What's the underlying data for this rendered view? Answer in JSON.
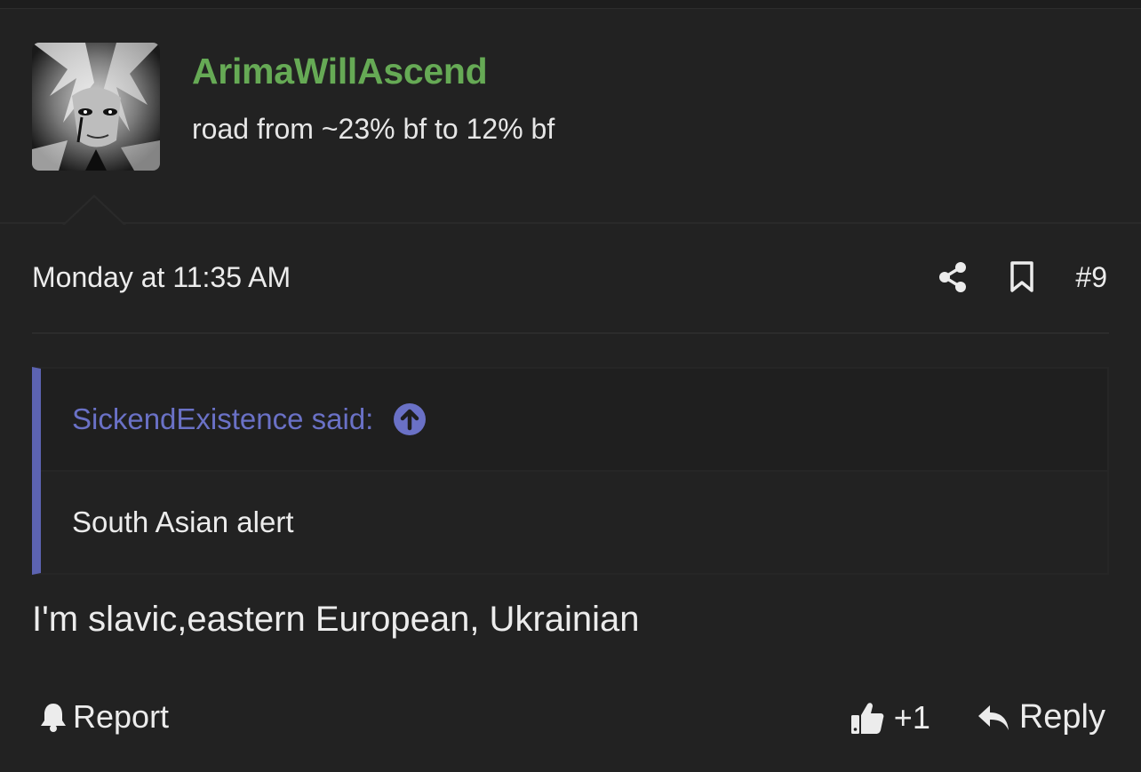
{
  "post": {
    "author": {
      "username": "ArimaWillAscend",
      "user_title": "road from ~23% bf to 12% bf",
      "username_color": "#66aa55"
    },
    "date": "Monday at 11:35 AM",
    "number": "#9",
    "meta_icons": [
      "share-icon",
      "bookmark-icon"
    ],
    "quote": {
      "attribution": "SickendExistence said:",
      "arrow_icon": "arrow-up-circle-icon",
      "body": "South Asian alert",
      "accent_color": "#5c63b1"
    },
    "message": "I'm slavic,eastern European, Ukrainian",
    "actions": {
      "report_label": "Report",
      "report_icon": "bell-icon",
      "like_count": "+1",
      "like_icon": "thumbs-up-icon",
      "reply_label": "Reply",
      "reply_icon": "reply-arrow-icon"
    }
  }
}
